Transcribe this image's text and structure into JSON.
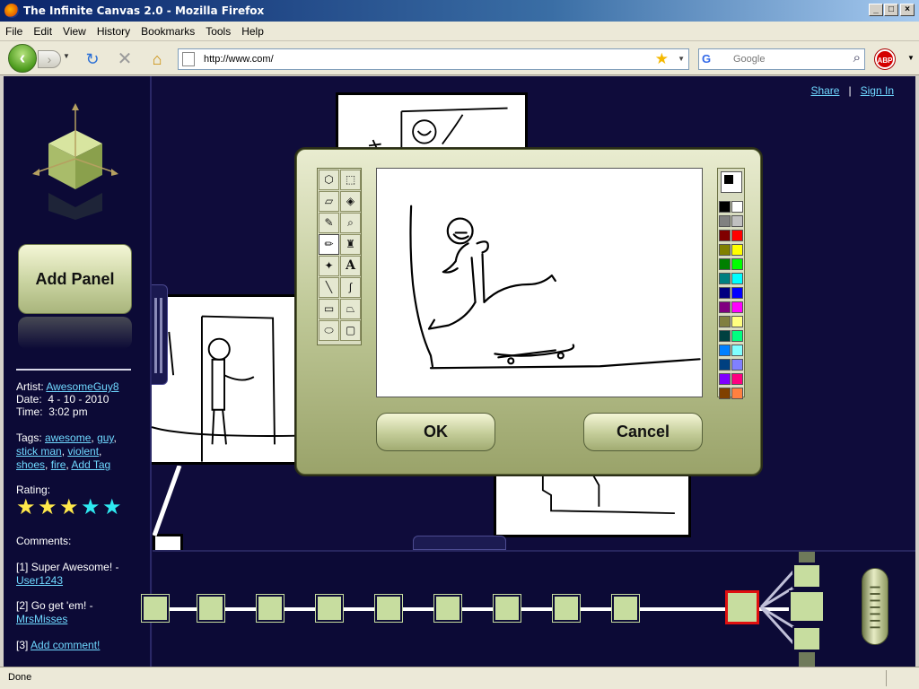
{
  "browser": {
    "window_title": "The Infinite Canvas 2.0 - Mozilla Firefox",
    "menu": [
      "File",
      "Edit",
      "View",
      "History",
      "Bookmarks",
      "Tools",
      "Help"
    ],
    "url": "http://www.com/",
    "search_placeholder": "Google",
    "addon_label": "ABP",
    "status": "Done"
  },
  "header": {
    "share": "Share",
    "separator": "|",
    "sign_in": "Sign In"
  },
  "sidebar": {
    "add_panel": "Add Panel",
    "artist_label": "Artist:",
    "artist": "AwesomeGuy8",
    "date_label": "Date:",
    "date": "4 - 10 - 2010",
    "time_label": "Time:",
    "time": "3:02 pm",
    "tags_label": "Tags:",
    "tags": [
      "awesome",
      "guy",
      "stick man",
      "violent",
      "shoes",
      "fire"
    ],
    "add_tag": "Add Tag",
    "rating_label": "Rating:",
    "rating": 5,
    "comments_label": "Comments:",
    "comments": [
      {
        "num": "[1]",
        "text": "Super Awesome! -",
        "user": "User1243"
      },
      {
        "num": "[2]",
        "text": "Go get 'em! -",
        "user": "MrsMisses"
      }
    ],
    "add_comment_num": "[3]",
    "add_comment": "Add comment!"
  },
  "dialog": {
    "ok": "OK",
    "cancel": "Cancel",
    "palette": [
      "#000000",
      "#ffffff",
      "#808080",
      "#c0c0c0",
      "#800000",
      "#ff0000",
      "#808000",
      "#ffff00",
      "#008000",
      "#00ff00",
      "#008080",
      "#00ffff",
      "#000080",
      "#0000ff",
      "#800080",
      "#ff00ff",
      "#808040",
      "#ffff80",
      "#004040",
      "#00ff80",
      "#0080ff",
      "#80ffff",
      "#004080",
      "#8080ff",
      "#8000ff",
      "#ff0080",
      "#804000",
      "#ff8040"
    ],
    "tools": [
      "free-select",
      "rect-select",
      "eraser",
      "fill",
      "color-picker",
      "magnifier",
      "pencil",
      "brush",
      "airbrush",
      "text",
      "line",
      "curve",
      "rectangle",
      "polygon",
      "ellipse",
      "rounded-rect"
    ]
  },
  "timeline": {
    "frames": 10,
    "selected_index": 10
  }
}
